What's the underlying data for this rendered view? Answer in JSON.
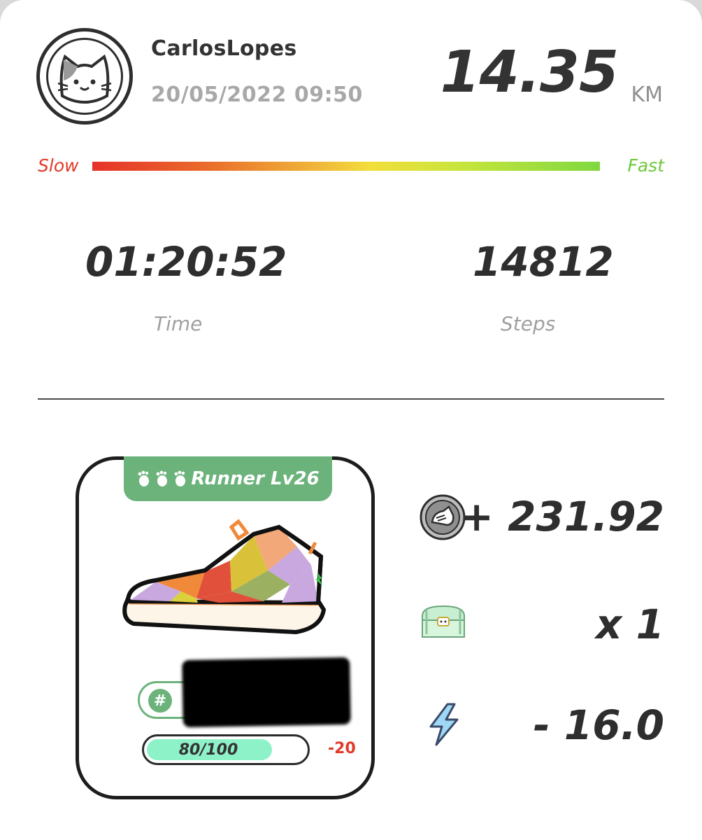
{
  "user": {
    "name": "CarlosLopes",
    "datetime": "20/05/2022 09:50",
    "avatar_icon": "cat-avatar-icon"
  },
  "distance": {
    "value": "14.35",
    "unit": "KM"
  },
  "pace": {
    "slow_label": "Slow",
    "fast_label": "Fast"
  },
  "stats": {
    "time": {
      "value": "01:20:52",
      "label": "Time"
    },
    "steps": {
      "value": "14812",
      "label": "Steps"
    }
  },
  "sneaker": {
    "level_label": "Runner Lv26",
    "id_prefix": "#",
    "durability": {
      "text": "80/100",
      "fraction": 0.8,
      "delta": "-20"
    }
  },
  "rewards": {
    "gst": {
      "value": "+ 231.92",
      "icon": "gst-coin-icon"
    },
    "mystery_box": {
      "value": "x 1",
      "icon": "treasure-chest-icon"
    },
    "energy": {
      "value": "- 16.0",
      "icon": "lightning-bolt-icon"
    }
  },
  "colors": {
    "accent_green": "#6bb37b",
    "slow_red": "#e23a2a",
    "fast_green": "#6cc93a",
    "durability_fill": "#8ef2c8"
  }
}
